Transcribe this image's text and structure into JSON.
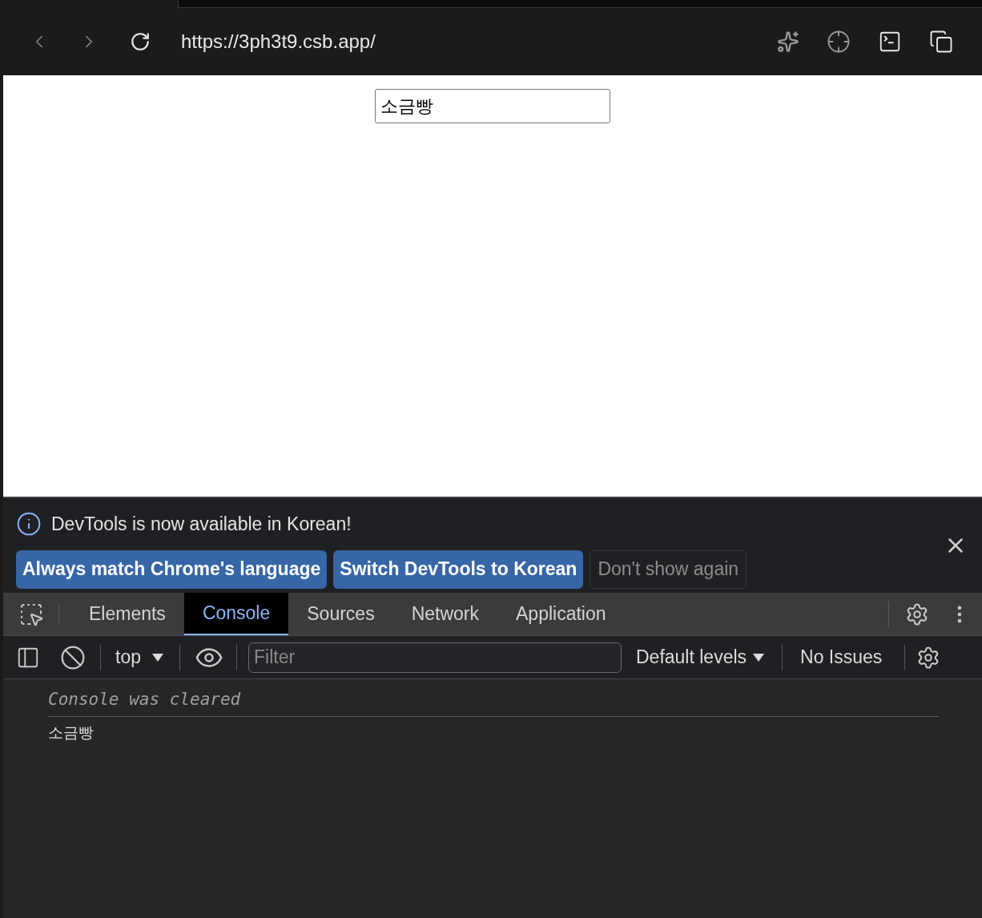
{
  "browser": {
    "url": "https://3ph3t9.csb.app/"
  },
  "page": {
    "input_value": "소금빵"
  },
  "infobar": {
    "message": "DevTools is now available in Korean!",
    "buttons": [
      {
        "label": "Always match Chrome's language",
        "kind": "primary"
      },
      {
        "label": "Switch DevTools to Korean",
        "kind": "primary"
      },
      {
        "label": "Don't show again",
        "kind": "secondary"
      }
    ]
  },
  "tabs": [
    {
      "label": "Elements",
      "selected": false
    },
    {
      "label": "Console",
      "selected": true
    },
    {
      "label": "Sources",
      "selected": false
    },
    {
      "label": "Network",
      "selected": false
    },
    {
      "label": "Application",
      "selected": false
    }
  ],
  "console_toolbar": {
    "context": "top",
    "filter_placeholder": "Filter",
    "levels": "Default levels",
    "issues": "No Issues"
  },
  "messages": [
    {
      "kind": "info",
      "text": "Console was cleared"
    },
    {
      "kind": "log",
      "text": "소금빵"
    }
  ]
}
